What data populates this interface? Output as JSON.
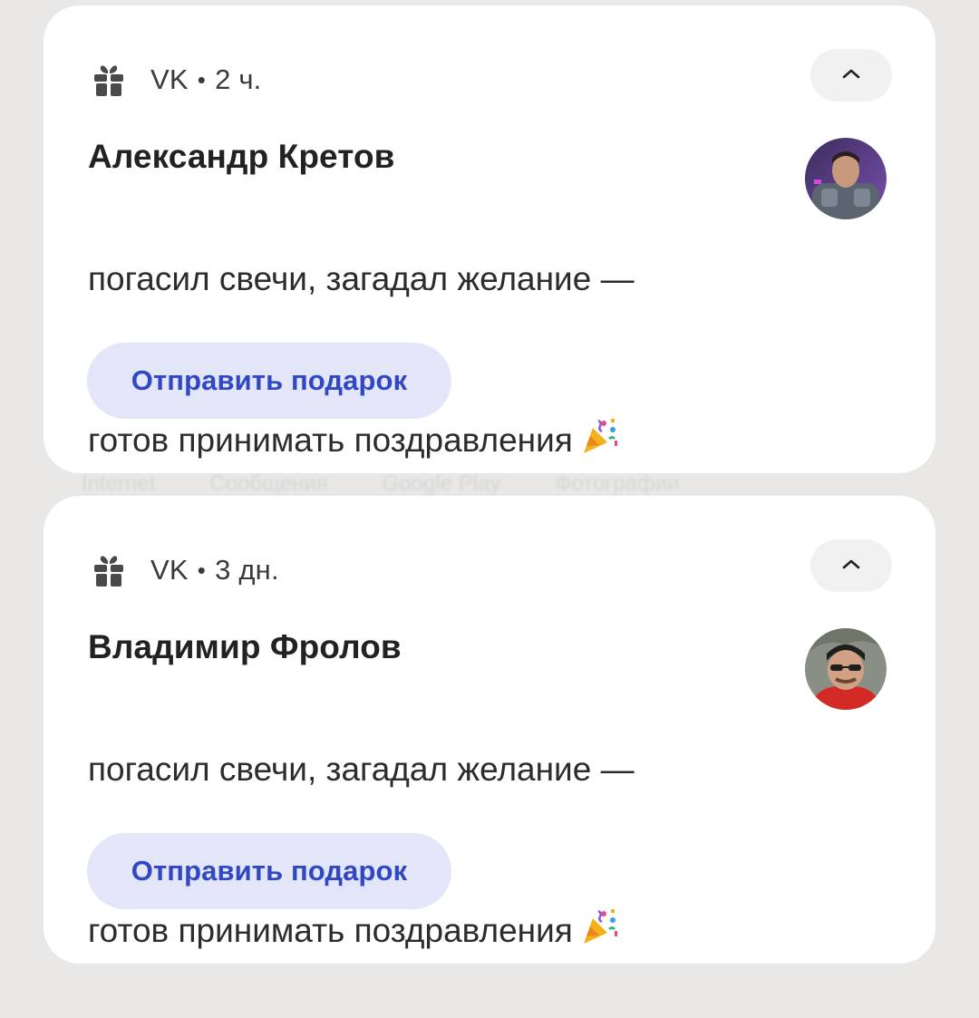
{
  "background_hint": {
    "items": [
      "Internet",
      "Сообщения",
      "Google Play",
      "Фотографии"
    ]
  },
  "notifications": [
    {
      "app_name": "VK",
      "separator": "•",
      "time": "2 ч.",
      "sender": "Александр Кретов",
      "message_line1": "погасил свечи, загадал желание —",
      "message_line2": "готов принимать поздравления",
      "emoji_icon": "party-popper-icon",
      "avatar_icon": "avatar-portrait",
      "action_label": "Отправить подарок",
      "expand_icon": "chevron-up-icon"
    },
    {
      "app_name": "VK",
      "separator": "•",
      "time": "3 дн.",
      "sender": "Владимир Фролов",
      "message_line1": "погасил свечи, загадал желание —",
      "message_line2": "готов принимать поздравления",
      "emoji_icon": "party-popper-icon",
      "avatar_icon": "avatar-portrait",
      "action_label": "Отправить подарок",
      "expand_icon": "chevron-up-icon"
    }
  ],
  "colors": {
    "page_bg": "#e9e8e7",
    "card_bg": "#ffffff",
    "action_bg": "#e3e6f8",
    "action_text": "#3048c4"
  }
}
